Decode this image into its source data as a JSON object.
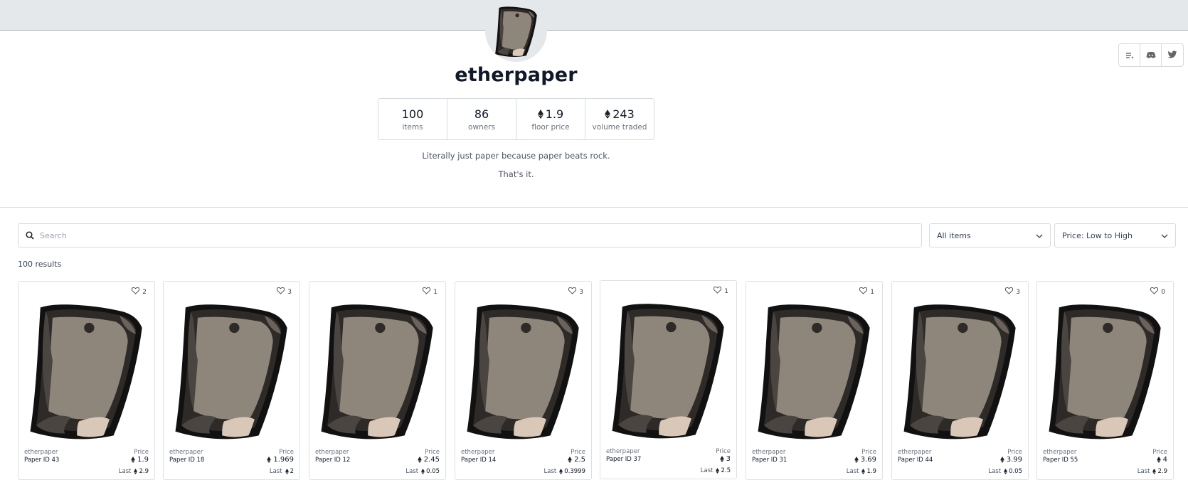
{
  "collection": {
    "name": "etherpaper",
    "description_line1": "Literally just paper because paper beats rock.",
    "description_line2": "That's it."
  },
  "stats": [
    {
      "value": "100",
      "label": "items",
      "eth": false
    },
    {
      "value": "86",
      "label": "owners",
      "eth": false
    },
    {
      "value": "1.9",
      "label": "floor price",
      "eth": true
    },
    {
      "value": "243",
      "label": "volume traded",
      "eth": true
    }
  ],
  "social_links": [
    "list-icon",
    "discord-icon",
    "twitter-icon"
  ],
  "search": {
    "placeholder": "Search",
    "value": ""
  },
  "filters": {
    "items_select": "All items",
    "sort_select": "Price: Low to High"
  },
  "results": {
    "count_text": "100 results"
  },
  "cards": [
    {
      "collection": "etherpaper",
      "name": "Paper ID 43",
      "price_label": "Price",
      "price": "1.9",
      "last_label": "Last",
      "last": "2.9",
      "likes": "2"
    },
    {
      "collection": "etherpaper",
      "name": "Paper ID 18",
      "price_label": "Price",
      "price": "1.969",
      "last_label": "Last",
      "last": "2",
      "likes": "3"
    },
    {
      "collection": "etherpaper",
      "name": "Paper ID 12",
      "price_label": "Price",
      "price": "2.45",
      "last_label": "Last",
      "last": "0.05",
      "likes": "1"
    },
    {
      "collection": "etherpaper",
      "name": "Paper ID 14",
      "price_label": "Price",
      "price": "2.5",
      "last_label": "Last",
      "last": "0.3999",
      "likes": "3"
    },
    {
      "collection": "etherpaper",
      "name": "Paper ID 37",
      "price_label": "Price",
      "price": "3",
      "last_label": "Last",
      "last": "2.5",
      "likes": "1"
    },
    {
      "collection": "etherpaper",
      "name": "Paper ID 31",
      "price_label": "Price",
      "price": "3.69",
      "last_label": "Last",
      "last": "1.9",
      "likes": "1"
    },
    {
      "collection": "etherpaper",
      "name": "Paper ID 44",
      "price_label": "Price",
      "price": "3.99",
      "last_label": "Last",
      "last": "0.05",
      "likes": "3"
    },
    {
      "collection": "etherpaper",
      "name": "Paper ID 55",
      "price_label": "Price",
      "price": "4",
      "last_label": "Last",
      "last": "2.9",
      "likes": "0"
    }
  ],
  "colors": {
    "banner": "#e5e8eb",
    "border": "#d7dbe0",
    "paper": "#8e857b",
    "paper_dark": "#4a4541"
  }
}
